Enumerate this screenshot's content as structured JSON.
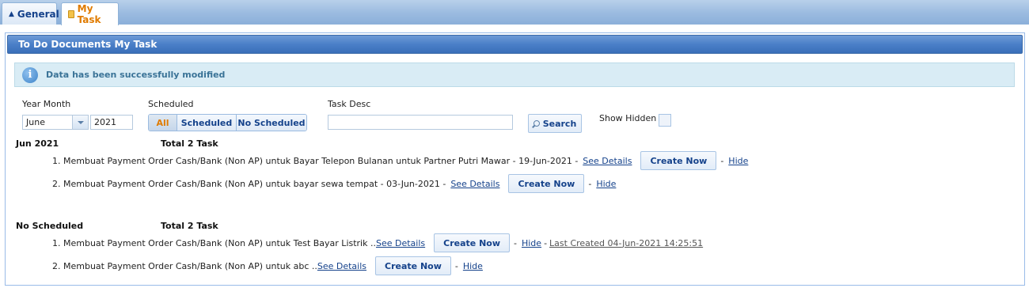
{
  "tabs": [
    {
      "label": "General"
    },
    {
      "label": "My Task"
    }
  ],
  "panel": {
    "title": "To Do Documents My Task"
  },
  "notice": {
    "message": "Data has been successfully modified"
  },
  "filters": {
    "year_month_label": "Year Month",
    "month_value": "June",
    "year_value": "2021",
    "scheduled_label": "Scheduled",
    "scheduled_options": [
      "All",
      "Scheduled",
      "No Scheduled"
    ],
    "scheduled_selected": "All",
    "task_desc_label": "Task Desc",
    "task_desc_value": "",
    "search_label": "Search",
    "show_hidden_label": "Show Hidden ?"
  },
  "groups": [
    {
      "title": "Jun 2021",
      "total": "Total 2 Task",
      "tasks": [
        {
          "text": "1. Membuat Payment Order Cash/Bank (Non AP) untuk Bayar Telepon Bulanan untuk Partner Putri Mawar - 19-Jun-2021 -",
          "see": "See Details",
          "create": "Create Now",
          "hide": "Hide"
        },
        {
          "text": "2. Membuat Payment Order Cash/Bank (Non AP) untuk bayar sewa tempat - 03-Jun-2021 -",
          "see": "See Details",
          "create": "Create Now",
          "hide": "Hide"
        }
      ]
    },
    {
      "title": "No Scheduled",
      "total": "Total 2 Task",
      "tasks": [
        {
          "text": "1. Membuat Payment Order Cash/Bank (Non AP) untuk Test Bayar Listrik ..",
          "see": "See Details",
          "create": "Create Now",
          "hide": "Hide",
          "extra": "Last Created 04-Jun-2021 14:25:51"
        },
        {
          "text": "2. Membuat Payment Order Cash/Bank (Non AP) untuk abc ..",
          "see": "See Details",
          "create": "Create Now",
          "hide": "Hide"
        }
      ]
    }
  ]
}
